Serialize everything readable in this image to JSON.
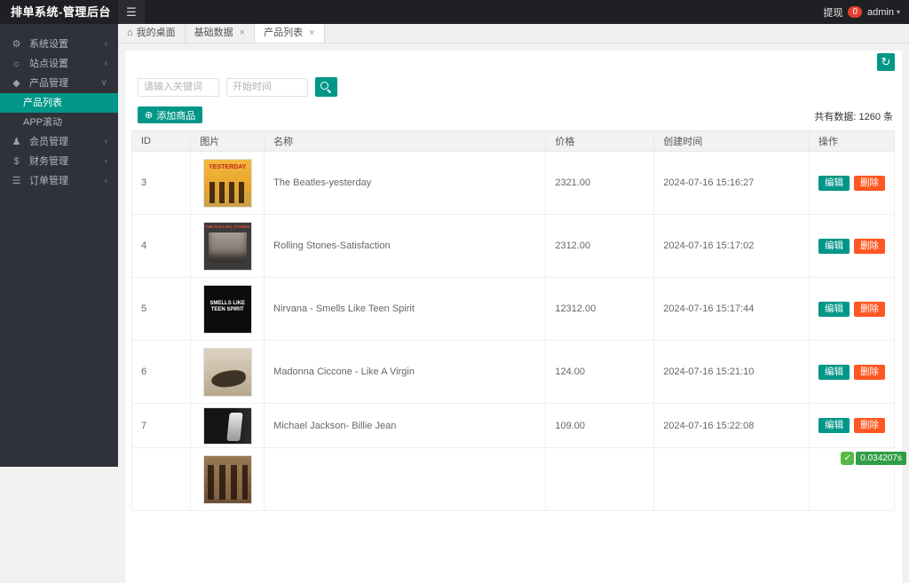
{
  "topbar": {
    "title": "排单系统-管理后台",
    "withdraw": "提现",
    "withdraw_badge": "0",
    "user": "admin"
  },
  "sidebar": {
    "items": [
      {
        "label": "系统设置"
      },
      {
        "label": "站点设置"
      },
      {
        "label": "产品管理"
      },
      {
        "label": "产品列表"
      },
      {
        "label": "APP滚动"
      },
      {
        "label": "会员管理"
      },
      {
        "label": "财务管理"
      },
      {
        "label": "订单管理"
      }
    ]
  },
  "tabs": {
    "items": [
      {
        "label": "我的桌面"
      },
      {
        "label": "基础数据"
      },
      {
        "label": "产品列表"
      }
    ]
  },
  "toolbar": {
    "keyword_placeholder": "请输入关键词",
    "date_placeholder": "开始时间",
    "add_label": "添加商品",
    "total_text": "共有数据: 1260 条"
  },
  "table": {
    "headers": [
      "ID",
      "图片",
      "名称",
      "价格",
      "创建时间",
      "操作"
    ],
    "edit_label": "编辑",
    "delete_label": "删除",
    "rows": [
      {
        "id": "3",
        "name": "The Beatles-yesterday",
        "price": "2321.00",
        "created": "2024-07-16 15:16:27",
        "cover_text": "YESTERDAY"
      },
      {
        "id": "4",
        "name": "Rolling Stones-Satisfaction",
        "price": "2312.00",
        "created": "2024-07-16 15:17:02",
        "cover_text": "THE ROLLING STONES"
      },
      {
        "id": "5",
        "name": "Nirvana - Smells Like Teen Spirit",
        "price": "12312.00",
        "created": "2024-07-16 15:17:44",
        "cover_text": "SMELLS LIKE TEEN SPIRIT"
      },
      {
        "id": "6",
        "name": "Madonna Ciccone - Like A Virgin",
        "price": "124.00",
        "created": "2024-07-16 15:21:10",
        "cover_text": ""
      },
      {
        "id": "7",
        "name": "Michael Jackson- Billie Jean",
        "price": "109.00",
        "created": "2024-07-16 15:22:08",
        "cover_text": ""
      },
      {
        "id": "",
        "name": "",
        "price": "",
        "created": "",
        "cover_text": ""
      }
    ]
  },
  "footer": {
    "elapsed": "0.034207s"
  }
}
